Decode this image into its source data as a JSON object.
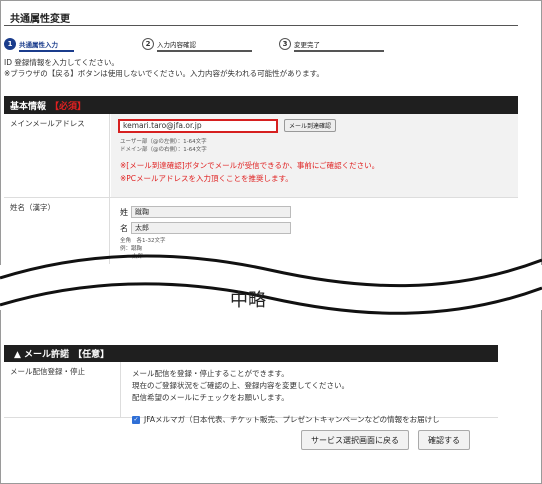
{
  "page": {
    "title": "共通属性変更"
  },
  "steps": [
    {
      "num": "1",
      "label": "共通属性入力"
    },
    {
      "num": "2",
      "label": "入力内容確認"
    },
    {
      "num": "3",
      "label": "変更完了"
    }
  ],
  "intro": {
    "line1": "ID 登録情報を入力してください。",
    "line2": "※ブラウザの【戻る】ボタンは使用しないでください。入力内容が失われる可能性があります。"
  },
  "basic": {
    "heading": "基本情報",
    "required": "【必須】",
    "email": {
      "label": "メインメールアドレス",
      "value": "kemari.taro@jfa.or.jp",
      "button": "メール到達確認",
      "hint1": "ユーザー部（@の左側）：1-64文字",
      "hint2": "ドメイン部（@の右側）：1-64文字",
      "warn1": "※[メール到達確認]ボタンでメールが受信できるか、事前にご確認ください。",
      "warn2": "※PCメールアドレスを入力頂くことを推奨します。"
    },
    "name": {
      "label": "姓名（漢字）",
      "sei_label": "姓",
      "sei_value": "蹴鞠",
      "mei_label": "名",
      "mei_value": "太郎",
      "hint1": "全角　各1-32文字",
      "hint2": "例：蹴鞠",
      "hint3": "太郎"
    }
  },
  "omission": "中略",
  "mail": {
    "heading": "▲ メール許諾",
    "optional": "【任意】",
    "label": "メール配信登録・停止",
    "line1": "メール配信を登録・停止することができます。",
    "line2": "現在のご登録状況をご確認の上、登録内容を変更してください。",
    "line3": "配信希望のメールにチェックをお願いします。",
    "option": "JFAメルマガ（日本代表、チケット販売、プレゼントキャンペーンなどの情報をお届けし"
  },
  "buttons": {
    "back": "サービス選択画面に戻る",
    "confirm": "確認する"
  }
}
